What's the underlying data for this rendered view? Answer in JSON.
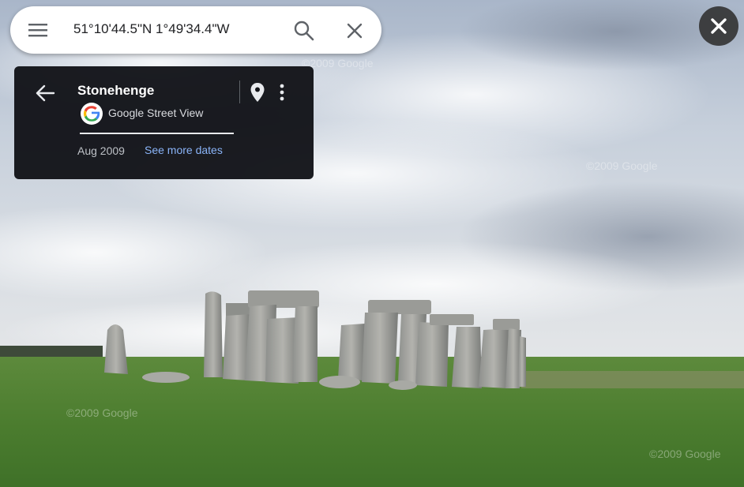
{
  "search": {
    "query": "51°10'44.5\"N 1°49'34.4\"W"
  },
  "place_card": {
    "title": "Stonehenge",
    "source": "Google Street View",
    "capture_date": "Aug 2009",
    "more_dates_label": "See more dates"
  },
  "watermarks": [
    "©2009 Google",
    "©2009 Google",
    "©2009 Google",
    "©2009 Google"
  ],
  "icons": {
    "menu": "hamburger-menu-icon",
    "search": "search-icon",
    "clear": "close-icon",
    "exit": "close-icon",
    "back": "arrow-left-icon",
    "pin": "location-pin-icon",
    "more": "more-vert-icon",
    "logo": "google-g-logo"
  },
  "colors": {
    "card_bg": "#121318",
    "link": "#8ab4f8",
    "close_circle": "#323232"
  }
}
